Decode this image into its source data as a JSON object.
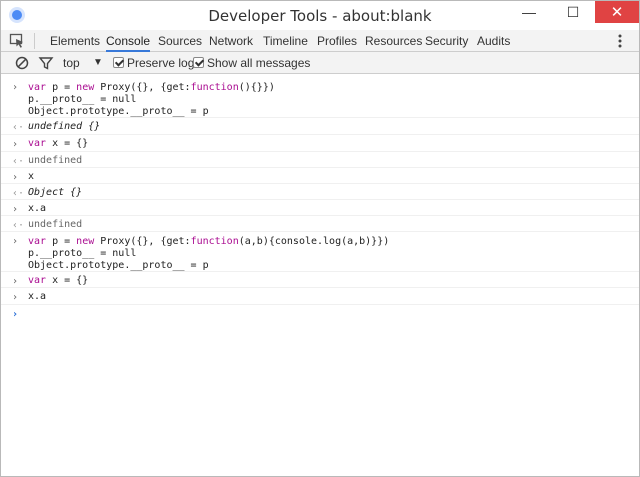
{
  "window": {
    "title": "Developer Tools - about:blank"
  },
  "tabs": [
    "Elements",
    "Console",
    "Sources",
    "Network",
    "Timeline",
    "Profiles",
    "Resources",
    "Security",
    "Audits"
  ],
  "toolbar": {
    "context": "top",
    "preserve_log": "Preserve log",
    "show_all": "Show all messages"
  },
  "console": {
    "e1": {
      "l1a": "var",
      "l1b": " p = ",
      "l1c": "new",
      "l1d": " Proxy({}, {get:",
      "l1e": "function",
      "l1f": "(){}})",
      "l2": "p.__proto__ = null",
      "l3": "Object.prototype.__proto__ = p"
    },
    "r1": "undefined {}",
    "e2": {
      "a": "var",
      "b": " x = {}"
    },
    "r2": "undefined",
    "e3": "x",
    "r3": "Object {}",
    "e4": "x.a",
    "r4": "undefined",
    "e5": {
      "l1a": "var",
      "l1b": " p = ",
      "l1c": "new",
      "l1d": " Proxy({}, {get:",
      "l1e": "function",
      "l1f": "(a,b){console.log(a,b)}})",
      "l2": "p.__proto__ = null",
      "l3": "Object.prototype.__proto__ = p"
    },
    "e6": {
      "a": "var",
      "b": " x = {}"
    },
    "e7": "x.a"
  },
  "glyphs": {
    "input": "›",
    "output": "‹·",
    "prompt": "›"
  },
  "colors": {
    "accent": "#3879d9",
    "keyword": "#aa0d91",
    "close": "#e04343"
  }
}
